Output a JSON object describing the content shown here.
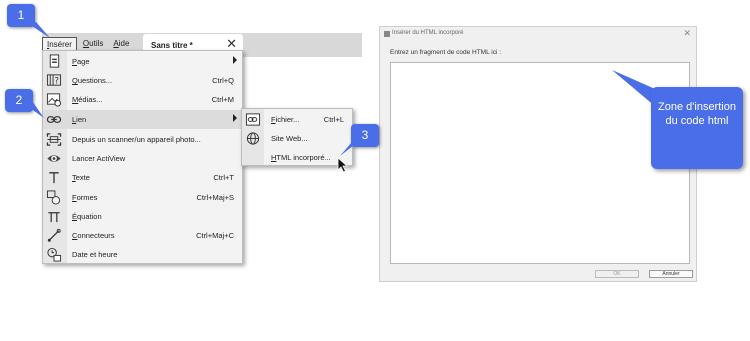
{
  "menubar": {
    "items": [
      {
        "label_u": "I",
        "label_rest": "nsérer"
      },
      {
        "label_u": "O",
        "label_rest": "utils"
      },
      {
        "label_u": "A",
        "label_rest": "ide"
      }
    ]
  },
  "doc_tab": {
    "title": "Sans titre *",
    "close": "✕"
  },
  "menu": {
    "items": [
      {
        "u": "P",
        "rest": "age",
        "shortcut": ""
      },
      {
        "u": "Q",
        "rest": "uestions...",
        "shortcut": "Ctrl+Q"
      },
      {
        "u": "M",
        "rest": "édias...",
        "shortcut": "Ctrl+M"
      },
      {
        "u": "L",
        "rest": "ien",
        "shortcut": ""
      },
      {
        "u": "",
        "rest": "Depuis un scanner/un appareil photo...",
        "shortcut": ""
      },
      {
        "u": "",
        "rest": "Lancer ActiView",
        "shortcut": ""
      },
      {
        "u": "T",
        "rest": "exte",
        "shortcut": "Ctrl+T"
      },
      {
        "u": "F",
        "rest": "ormes",
        "shortcut": "Ctrl+Maj+S"
      },
      {
        "u": "É",
        "rest": "quation",
        "shortcut": ""
      },
      {
        "u": "C",
        "rest": "onnecteurs",
        "shortcut": "Ctrl+Maj+C"
      },
      {
        "u": "",
        "rest": "Date et heure",
        "shortcut": ""
      }
    ]
  },
  "submenu": {
    "items": [
      {
        "u": "F",
        "rest": "ichier...",
        "shortcut": "Ctrl+L"
      },
      {
        "u": "",
        "rest": "Site Web...",
        "shortcut": ""
      },
      {
        "u": "H",
        "rest": "TML incorporé...",
        "shortcut": ""
      }
    ]
  },
  "dialog": {
    "title": "Insérer du HTML incorporé",
    "close": "✕",
    "prompt": "Entrez un fragment de code HTML ici :",
    "textarea_value": "",
    "ok": "OK",
    "cancel": "Annuler"
  },
  "callouts": {
    "badge1": "1",
    "badge2": "2",
    "badge3": "3",
    "bubble": "Zone d'insertion du code html"
  },
  "colors": {
    "callout": "#4a6ee8",
    "menu_bg": "#f3f3f3",
    "highlight": "#dcdcdc"
  }
}
